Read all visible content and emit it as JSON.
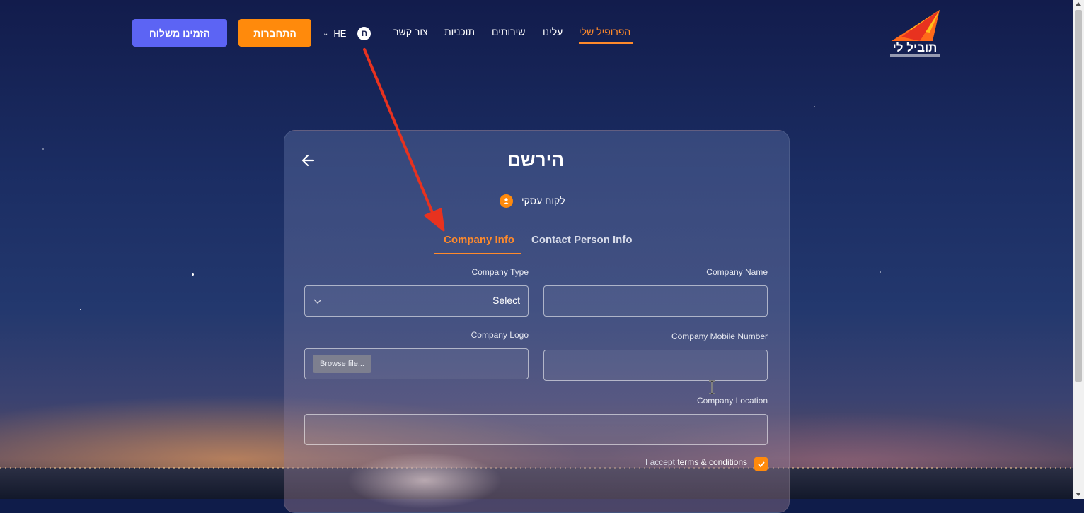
{
  "header": {
    "order_label": "הזמינו משלוח",
    "login_label": "התחברות",
    "language": "HE",
    "nav": {
      "profile": "הפרופיל שלי",
      "about": "עלינו",
      "services": "שירותים",
      "plans": "תוכניות",
      "contact": "צור קשר"
    },
    "logo_text": "תוביל לי"
  },
  "form": {
    "title": "הירשם",
    "client_type": "לקוח עסקי",
    "tabs": {
      "company_info": "Company Info",
      "contact_person": "Contact Person Info"
    },
    "fields": {
      "company_name_label": "Company Name",
      "company_type_label": "Company Type",
      "company_type_value": "Select",
      "company_mobile_label": "Company Mobile Number",
      "company_logo_label": "Company Logo",
      "browse_label": "Browse file...",
      "company_location_label": "Company Location"
    },
    "terms": {
      "prefix": "I accept ",
      "link": "terms & conditions",
      "checked": true
    }
  },
  "colors": {
    "accent_orange": "#ff8a0c",
    "accent_blue": "#5c64f4",
    "annotation_red": "#e8321f"
  }
}
